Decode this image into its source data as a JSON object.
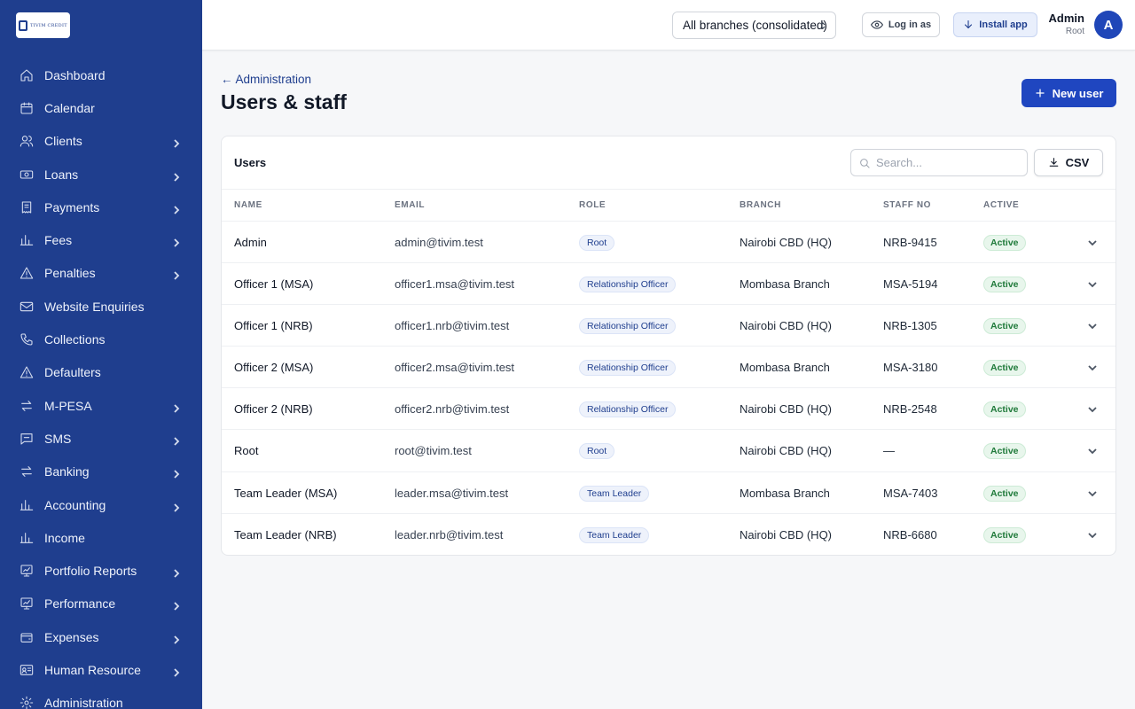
{
  "brand": {
    "logo_text": "TIVIM CREDIT"
  },
  "sidebar": {
    "items": [
      {
        "label": "Dashboard",
        "icon": "home-icon",
        "chevron": false
      },
      {
        "label": "Calendar",
        "icon": "calendar-icon",
        "chevron": false
      },
      {
        "label": "Clients",
        "icon": "users-icon",
        "chevron": true
      },
      {
        "label": "Loans",
        "icon": "banknote-icon",
        "chevron": true
      },
      {
        "label": "Payments",
        "icon": "receipt-icon",
        "chevron": true
      },
      {
        "label": "Fees",
        "icon": "bar-chart-icon",
        "chevron": true
      },
      {
        "label": "Penalties",
        "icon": "alert-triangle-icon",
        "chevron": true
      },
      {
        "label": "Website Enquiries",
        "icon": "mail-icon",
        "chevron": false
      },
      {
        "label": "Collections",
        "icon": "phone-icon",
        "chevron": false
      },
      {
        "label": "Defaulters",
        "icon": "alert-triangle-icon",
        "chevron": false
      },
      {
        "label": "M-PESA",
        "icon": "arrows-swap-icon",
        "chevron": true
      },
      {
        "label": "SMS",
        "icon": "message-icon",
        "chevron": true
      },
      {
        "label": "Banking",
        "icon": "arrows-swap-icon",
        "chevron": true
      },
      {
        "label": "Accounting",
        "icon": "bar-chart-icon",
        "chevron": true
      },
      {
        "label": "Income",
        "icon": "bar-chart-icon",
        "chevron": false
      },
      {
        "label": "Portfolio Reports",
        "icon": "chart-board-icon",
        "chevron": true
      },
      {
        "label": "Performance",
        "icon": "chart-board-icon",
        "chevron": true
      },
      {
        "label": "Expenses",
        "icon": "wallet-icon",
        "chevron": true
      },
      {
        "label": "Human Resource",
        "icon": "id-card-icon",
        "chevron": true
      },
      {
        "label": "Administration",
        "icon": "gear-icon",
        "chevron": false
      }
    ]
  },
  "topbar": {
    "branch_select": "All branches (consolidated)",
    "login_as_label": "Log in as",
    "install_label": "Install app",
    "user_name": "Admin",
    "user_role": "Root",
    "avatar_initial": "A"
  },
  "page": {
    "back_link": "← Administration",
    "title": "Users & staff",
    "new_user_label": "New user"
  },
  "card": {
    "title": "Users",
    "search_placeholder": "Search...",
    "csv_label": "CSV",
    "columns": [
      "NAME",
      "EMAIL",
      "ROLE",
      "BRANCH",
      "STAFF NO",
      "ACTIVE"
    ],
    "rows": [
      {
        "name": "Admin",
        "email": "admin@tivim.test",
        "role": "Root",
        "branch": "Nairobi CBD (HQ)",
        "staff_no": "NRB-9415",
        "active": "Active"
      },
      {
        "name": "Officer 1 (MSA)",
        "email": "officer1.msa@tivim.test",
        "role": "Relationship Officer",
        "branch": "Mombasa Branch",
        "staff_no": "MSA-5194",
        "active": "Active"
      },
      {
        "name": "Officer 1 (NRB)",
        "email": "officer1.nrb@tivim.test",
        "role": "Relationship Officer",
        "branch": "Nairobi CBD (HQ)",
        "staff_no": "NRB-1305",
        "active": "Active"
      },
      {
        "name": "Officer 2 (MSA)",
        "email": "officer2.msa@tivim.test",
        "role": "Relationship Officer",
        "branch": "Mombasa Branch",
        "staff_no": "MSA-3180",
        "active": "Active"
      },
      {
        "name": "Officer 2 (NRB)",
        "email": "officer2.nrb@tivim.test",
        "role": "Relationship Officer",
        "branch": "Nairobi CBD (HQ)",
        "staff_no": "NRB-2548",
        "active": "Active"
      },
      {
        "name": "Root",
        "email": "root@tivim.test",
        "role": "Root",
        "branch": "Nairobi CBD (HQ)",
        "staff_no": "—",
        "active": "Active"
      },
      {
        "name": "Team Leader (MSA)",
        "email": "leader.msa@tivim.test",
        "role": "Team Leader",
        "branch": "Mombasa Branch",
        "staff_no": "MSA-7403",
        "active": "Active"
      },
      {
        "name": "Team Leader (NRB)",
        "email": "leader.nrb@tivim.test",
        "role": "Team Leader",
        "branch": "Nairobi CBD (HQ)",
        "staff_no": "NRB-6680",
        "active": "Active"
      }
    ]
  },
  "colors": {
    "sidebar_bg": "#1f3e8e",
    "primary": "#1f46c0",
    "active_green": "#1f7a3a"
  }
}
